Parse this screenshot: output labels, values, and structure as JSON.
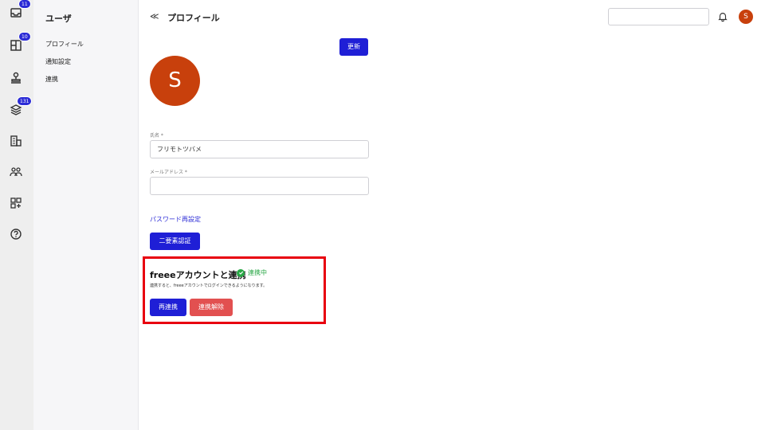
{
  "rail": {
    "items": [
      {
        "icon": "inbox-icon",
        "badge": "11"
      },
      {
        "icon": "board-icon",
        "badge": "10"
      },
      {
        "icon": "stamp-icon",
        "badge": ""
      },
      {
        "icon": "layers-icon",
        "badge": "131"
      },
      {
        "icon": "building-icon",
        "badge": ""
      },
      {
        "icon": "users-icon",
        "badge": ""
      },
      {
        "icon": "apps-add-icon",
        "badge": ""
      },
      {
        "icon": "help-icon",
        "badge": ""
      }
    ]
  },
  "subnav": {
    "title": "ユーザ",
    "items": [
      "プロフィール",
      "通知設定",
      "連携"
    ]
  },
  "header": {
    "back": "≪",
    "title": "プロフィール",
    "avatar_initial": "S",
    "search_value": ""
  },
  "profile": {
    "update_label": "更新",
    "avatar_initial": "S",
    "name_label": "氏名 *",
    "name_value": "フリモトツバメ",
    "email_label": "メールアドレス *",
    "email_value": "",
    "password_link": "パスワード再設定",
    "mfa_label": "二要素認証"
  },
  "freee": {
    "title": "freeeアカウントと連携",
    "status": "連携中",
    "description": "連携すると、freeeアカウントでログインできるようになります。",
    "reconnect_label": "再連携",
    "disconnect_label": "連携解除"
  },
  "colors": {
    "accent": "#1f1fd6",
    "avatar": "#c8400c",
    "success": "#28a745",
    "danger": "#e25050",
    "highlight": "#e8000f"
  }
}
